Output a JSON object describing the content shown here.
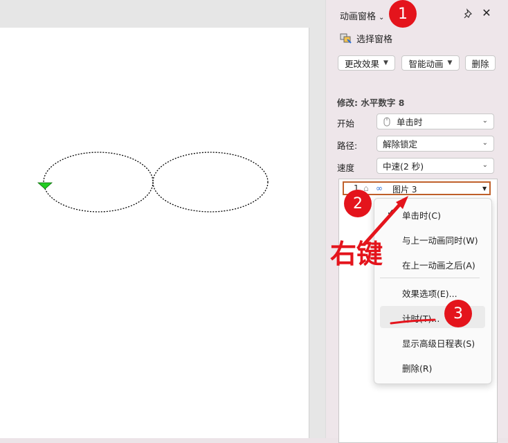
{
  "pane": {
    "title": "动画窗格",
    "select_pane": "选择窗格",
    "buttons": {
      "change_effect": "更改效果",
      "smart_animation": "智能动画",
      "delete": "删除"
    },
    "modify_label": "修改: 水平数字 8",
    "start_label": "开始",
    "start_value": "单击时",
    "path_label": "路径:",
    "path_value": "解除锁定",
    "speed_label": "速度",
    "speed_value": "中速(2 秒)",
    "list_item": {
      "index": "1",
      "name": "图片 3"
    }
  },
  "context_menu": {
    "items": [
      "单击时(C)",
      "与上一动画同时(W)",
      "在上一动画之后(A)",
      "效果选项(E)...",
      "计时(T)...",
      "显示高级日程表(S)",
      "删除(R)"
    ],
    "highlighted": "计时(T)..."
  },
  "annotations": {
    "badge_1": "1",
    "badge_2": "2",
    "badge_3": "3",
    "right_click_text": "右键",
    "color": "#e4141c"
  },
  "colors": {
    "accent": "#e4141c",
    "highlight_border": "#c0602a",
    "path_start": "#22cc22"
  }
}
